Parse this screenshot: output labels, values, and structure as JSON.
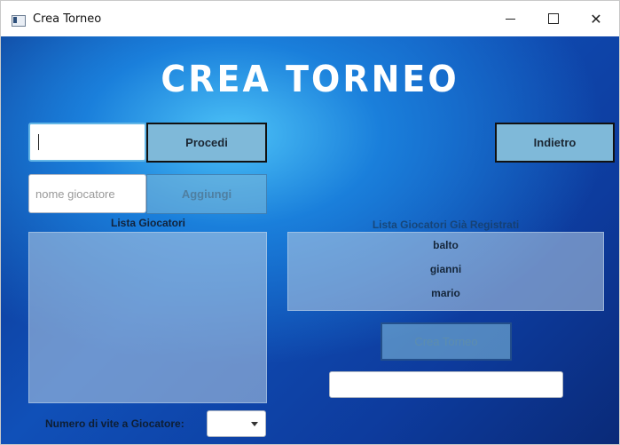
{
  "window": {
    "title": "Crea Torneo",
    "minimize_icon": "minimize-icon",
    "maximize_icon": "maximize-icon",
    "close_icon": "close-icon",
    "close_glyph": "✕"
  },
  "header": {
    "title": "CREA TORNEO"
  },
  "tournament_name": {
    "value": "",
    "placeholder": ""
  },
  "buttons": {
    "procedi": "Procedi",
    "indietro": "Indietro",
    "aggiungi": "Aggiungi",
    "crea_torneo": "Crea Torneo"
  },
  "player_input": {
    "placeholder": "nome giocatore"
  },
  "lists": {
    "players_label": "Lista Giocatori",
    "registered_label": "Lista Giocatori Già Registrati",
    "registered": [
      "balto",
      "gianni",
      "mario"
    ]
  },
  "status_field": {
    "value": ""
  },
  "lives": {
    "label": "Numero di vite a Giocatore:",
    "selected": ""
  }
}
